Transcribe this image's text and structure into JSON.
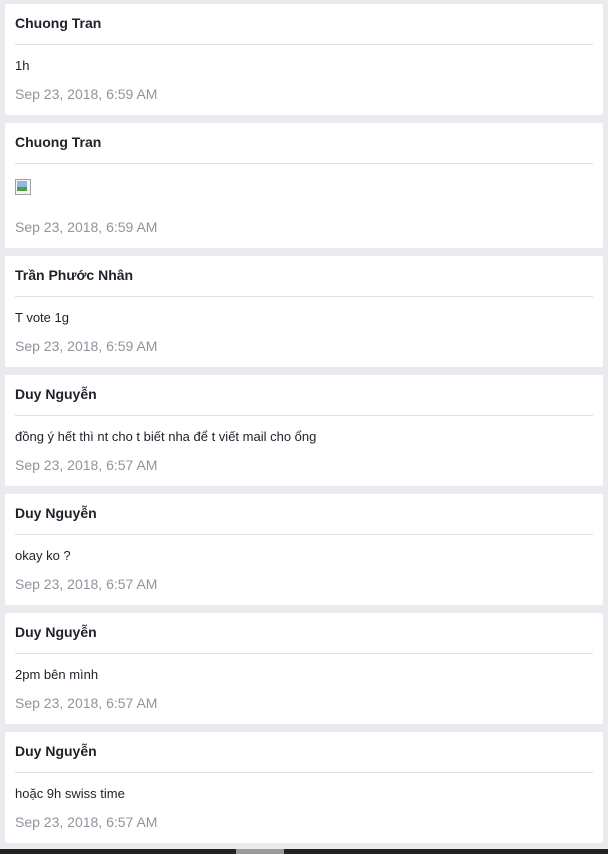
{
  "messages": [
    {
      "author": "Chuong Tran",
      "text": "1h",
      "time": "Sep 23, 2018, 6:59 AM"
    },
    {
      "author": "Chuong Tran",
      "text": "",
      "image_icon": "broken-image-icon",
      "time": "Sep 23, 2018, 6:59 AM"
    },
    {
      "author": "Trần Phước Nhân",
      "text": "T vote 1g",
      "time": "Sep 23, 2018, 6:59 AM"
    },
    {
      "author": "Duy Nguyễn",
      "text": "đồng ý hết thì nt cho t biết nha để t viết mail cho ổng",
      "time": "Sep 23, 2018, 6:57 AM"
    },
    {
      "author": "Duy Nguyễn",
      "text": "okay ko ?",
      "time": "Sep 23, 2018, 6:57 AM"
    },
    {
      "author": "Duy Nguyễn",
      "text": "2pm bên mình",
      "time": "Sep 23, 2018, 6:57 AM"
    },
    {
      "author": "Duy Nguyễn",
      "text": "hoặc 9h swiss time",
      "time": "Sep 23, 2018, 6:57 AM"
    }
  ]
}
